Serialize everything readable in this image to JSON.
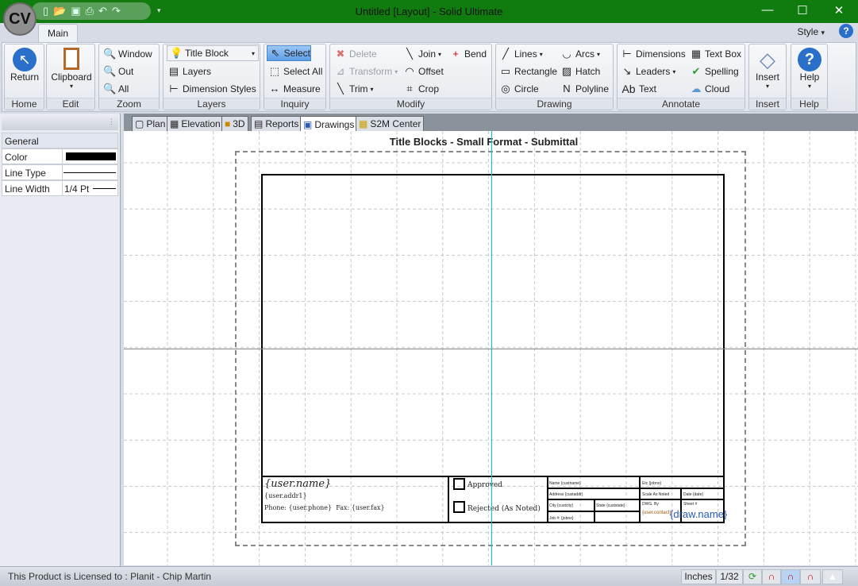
{
  "window": {
    "title": "Untitled [Layout] - Solid Ultimate",
    "logo": "CV",
    "accent": "#107c10"
  },
  "ribbon_tab": "Main",
  "style_label": "Style",
  "help_icon": "?",
  "groups": {
    "home": "Home",
    "edit": "Edit",
    "zoom": "Zoom",
    "layers": "Layers",
    "inquiry": "Inquiry",
    "modify": "Modify",
    "drawing": "Drawing",
    "annotate": "Annotate",
    "insert": "Insert",
    "help": "Help"
  },
  "buttons": {
    "return": "Return",
    "clipboard": "Clipboard",
    "window": "Window",
    "out": "Out",
    "all": "All",
    "layer_select": "Title Block",
    "layers": "Layers",
    "dimension_styles": "Dimension Styles",
    "select": "Select",
    "select_all": "Select All",
    "measure": "Measure",
    "delete": "Delete",
    "transform": "Transform",
    "trim": "Trim",
    "join": "Join",
    "offset": "Offset",
    "crop": "Crop",
    "bend": "Bend",
    "lines": "Lines",
    "rectangle": "Rectangle",
    "circle": "Circle",
    "arcs": "Arcs",
    "hatch": "Hatch",
    "polyline": "Polyline",
    "dimensions": "Dimensions",
    "leaders": "Leaders",
    "text": "Text",
    "text_box": "Text Box",
    "spelling": "Spelling",
    "cloud": "Cloud",
    "insert": "Insert",
    "help": "Help"
  },
  "properties": {
    "section": "General",
    "rows": [
      {
        "label": "Color",
        "value": ""
      },
      {
        "label": "Line Type",
        "value": ""
      },
      {
        "label": "Line Width",
        "value": "1/4 Pt"
      }
    ],
    "color_value": "#000000"
  },
  "view_tabs": [
    "Plan",
    "Elevation",
    "3D",
    "Reports",
    "Drawings",
    "S2M Center"
  ],
  "active_tab": "Drawings",
  "drawing": {
    "title": "Title Blocks - Small Format - Submittal",
    "user_name": "{user.name}",
    "user_addr": "{user.addr1}",
    "phone_line": "Phone: {user.phone}  Fax: {user.fax}",
    "approved": "Approved",
    "rejected": "Rejected (As Noted)",
    "fields": {
      "name": "Name {custname}",
      "address": "Address {custaddr}",
      "city": "City {custcity}",
      "state": "State {custstate}",
      "job": "Job #: {jobno}",
      "etc": "Etc {jobno}",
      "scale": "Scale As Noted",
      "date": "Date {date}",
      "dwg_by": "DWG. By",
      "sheet": "Sheet #",
      "user_contact": "{user.contact}",
      "draw_name": "{draw.name}"
    }
  },
  "status": {
    "license": "This Product is Licensed to : Planit - Chip Martin",
    "units": "Inches",
    "precision": "1/32"
  }
}
